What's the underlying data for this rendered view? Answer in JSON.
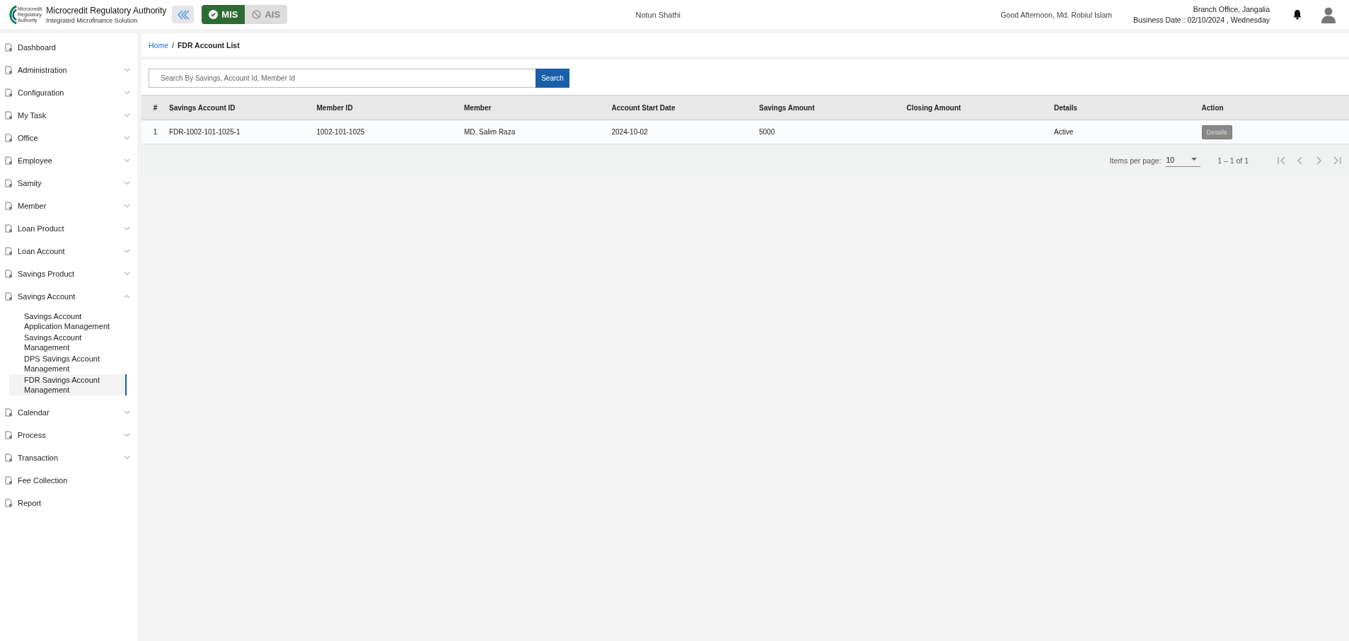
{
  "header": {
    "logo_lines": [
      "Microcredit",
      "Regulatory",
      "Authority"
    ],
    "title": "Microcredit Regulatory Authority",
    "subtitle": "Integrated Microfinance Solution",
    "modules": [
      {
        "label": "MIS",
        "selected": true
      },
      {
        "label": "AIS",
        "selected": false
      }
    ],
    "app_name": "Notun Shathi",
    "greeting": "Good Afternoon, Md. Robiul Islam",
    "branch": "Branch Office, Jangalia",
    "business_date": "Business Date : 02/10/2024 , Wednesday"
  },
  "sidebar": {
    "items": [
      {
        "label": "Dashboard",
        "kind": "link"
      },
      {
        "label": "Administration",
        "kind": "group",
        "expanded": false
      },
      {
        "label": "Configuration",
        "kind": "group",
        "expanded": false
      },
      {
        "label": "My Task",
        "kind": "group",
        "expanded": false
      },
      {
        "label": "Office",
        "kind": "group",
        "expanded": false
      },
      {
        "label": "Employee",
        "kind": "group",
        "expanded": false
      },
      {
        "label": "Samity",
        "kind": "group",
        "expanded": false
      },
      {
        "label": "Member",
        "kind": "group",
        "expanded": false
      },
      {
        "label": "Loan Product",
        "kind": "group",
        "expanded": false
      },
      {
        "label": "Loan Account",
        "kind": "group",
        "expanded": false
      },
      {
        "label": "Savings Product",
        "kind": "group",
        "expanded": false
      },
      {
        "label": "Savings Account",
        "kind": "group",
        "expanded": true,
        "children": [
          {
            "label": "Savings Account Application Management",
            "selected": false
          },
          {
            "label": "Savings Account Management",
            "selected": false
          },
          {
            "label": "DPS Savings Account Management",
            "selected": false
          },
          {
            "label": "FDR Savings Account Management",
            "selected": true
          }
        ]
      },
      {
        "label": "Calendar",
        "kind": "group",
        "expanded": false
      },
      {
        "label": "Process",
        "kind": "group",
        "expanded": false
      },
      {
        "label": "Transaction",
        "kind": "group",
        "expanded": false
      },
      {
        "label": "Fee Collection",
        "kind": "link"
      },
      {
        "label": "Report",
        "kind": "link"
      }
    ]
  },
  "breadcrumb": {
    "home": "Home",
    "separator": "/",
    "current": "FDR Account List"
  },
  "search": {
    "placeholder": "Search By Savings, Account Id, Member Id",
    "button": "Search"
  },
  "table": {
    "columns": [
      "#",
      "Savings Account ID",
      "Member ID",
      "Member",
      "Account Start Date",
      "Savings Amount",
      "Closing Amount",
      "Details",
      "Action"
    ],
    "rows": [
      {
        "cells": [
          "1",
          "FDR-1002-101-1025-1",
          "1002-101-1025",
          "MD. Salim Raza",
          "2024-10-02",
          "5000",
          "",
          "Active"
        ],
        "action": "Details"
      }
    ]
  },
  "paginator": {
    "label": "Items per page:",
    "page_size": "10",
    "range": "1 – 1 of 1"
  }
}
